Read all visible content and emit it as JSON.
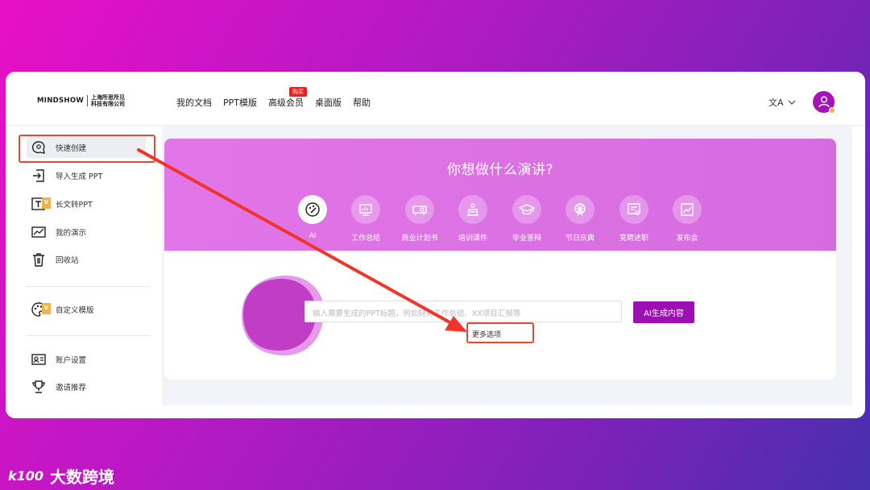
{
  "brand": {
    "logo_text": "MINDSHOW",
    "company_line1": "上海所思所见",
    "company_line2": "科技有限公司"
  },
  "nav": {
    "items": [
      "我的文档",
      "PPT模版",
      "高级会员",
      "桌面版",
      "帮助"
    ],
    "badge": "购买"
  },
  "header": {
    "lang_icon": "文A"
  },
  "sidebar": {
    "items": [
      {
        "label": "快速创建",
        "icon": "brain-icon"
      },
      {
        "label": "导入生成 PPT",
        "icon": "import-icon"
      },
      {
        "label": "长文转PPT",
        "icon": "text-icon"
      },
      {
        "label": "我的演示",
        "icon": "presentation-icon"
      },
      {
        "label": "回收站",
        "icon": "trash-icon"
      },
      {
        "label": "自定义模版",
        "icon": "palette-icon"
      },
      {
        "label": "账户设置",
        "icon": "account-icon"
      },
      {
        "label": "邀请推荐",
        "icon": "trophy-icon"
      }
    ],
    "vip_badge": "V"
  },
  "hero": {
    "title": "你想做什么演讲?",
    "categories": [
      "AI",
      "工作总结",
      "商业计划书",
      "培训课件",
      "毕业答辩",
      "节日庆典",
      "竞聘述职",
      "发布会"
    ]
  },
  "prompt": {
    "placeholder": "输入需要生成的PPT标题，例如财务工作总结、XX项目汇报等",
    "generate_label": "AI生成内容",
    "more_options": "更多选项"
  },
  "watermark": {
    "logo": "k100",
    "text": "大数跨境"
  },
  "colors": {
    "accent": "#9c0fb1",
    "highlight": "#e24a36",
    "hero": "#e275e7"
  }
}
